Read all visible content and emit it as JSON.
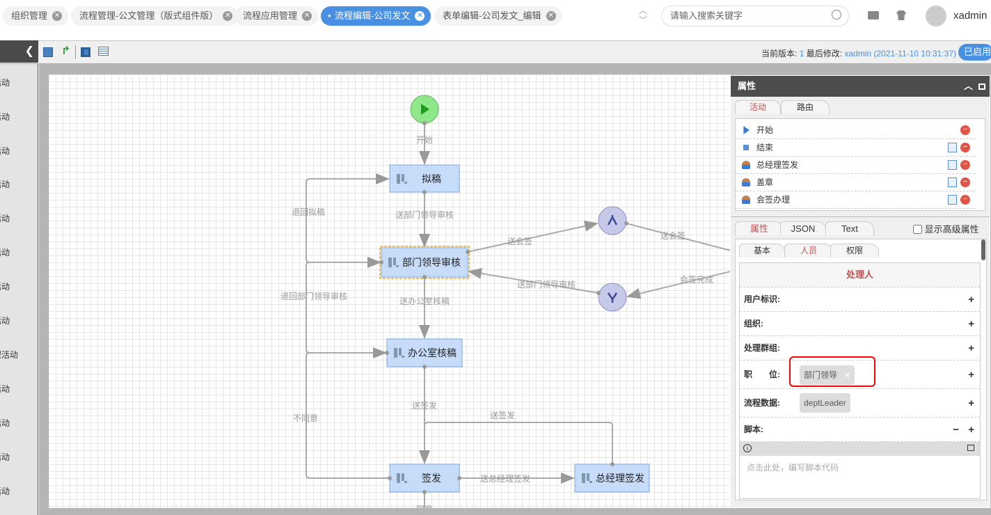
{
  "tabs": [
    {
      "label": "组织管理",
      "active": false
    },
    {
      "label": "流程管理-公文管理（版式组件版）",
      "active": false
    },
    {
      "label": "流程应用管理",
      "active": false
    },
    {
      "label": "流程编辑-公司发文",
      "active": true
    },
    {
      "label": "表单编辑-公司发文_编辑",
      "active": false
    }
  ],
  "header": {
    "search_placeholder": "请输入搜索关键字",
    "username": "xadmin"
  },
  "toolbar": {
    "version_label": "当前版本:",
    "version": "1",
    "modified_label": "最后修改:",
    "modified_by": "xadmin (2021-11-10 10:31:37)",
    "status": "已启用"
  },
  "sidebar": {
    "items": [
      "活动",
      "活动",
      "活动",
      "活动",
      "活动",
      "活动",
      "活动",
      "活动",
      "程活动",
      "活动",
      "活动",
      "活动",
      "活动"
    ]
  },
  "diagram": {
    "nodes": {
      "draft": "拟稿",
      "dept_review": "部门领导审核",
      "office_review": "办公室核稿",
      "issue": "签发",
      "gm_issue": "总经理签发"
    },
    "edges": {
      "start": "开始",
      "to_dept": "送部门领导审核",
      "to_office": "送办公室核稿",
      "to_issue": "送签发",
      "to_gm": "送总经理签发",
      "gm_back": "送签发",
      "to_countersign": "送会签",
      "countersign_out": "送会签",
      "countersign_done": "会签完成",
      "join_to_dept": "送部门领导审核",
      "back_draft": "退回拟稿",
      "back_dept": "退回部门领导审核",
      "disagree": "不同意",
      "agree": "同意"
    }
  },
  "panel": {
    "title": "属性",
    "top_tabs": [
      "活动",
      "路由"
    ],
    "activities": [
      "开始",
      "结束",
      "总经理签发",
      "盖章",
      "会签办理"
    ],
    "bottom_tabs": [
      "属性",
      "JSON",
      "Text"
    ],
    "advanced_label": "显示高级属性",
    "sub_tabs": [
      "基本",
      "人员",
      "权限"
    ],
    "section_title": "处理人",
    "fields": {
      "user": "用户标识:",
      "org": "组织:",
      "group": "处理群组:",
      "position": "职　　位:",
      "position_value": "部门领导",
      "flow_data": "流程数据:",
      "flow_data_value": "deptLeader",
      "script": "脚本:",
      "script_placeholder": "点击此处，编写脚本代码"
    }
  },
  "colors": {
    "accent": "#4a90e2",
    "node_fill": "#c6dcf8",
    "node_border": "#7aa7e0",
    "selected_border": "#f0a020",
    "start": "#8ee88a",
    "gateway": "#c7c9e8",
    "highlight": "#ff0000"
  }
}
